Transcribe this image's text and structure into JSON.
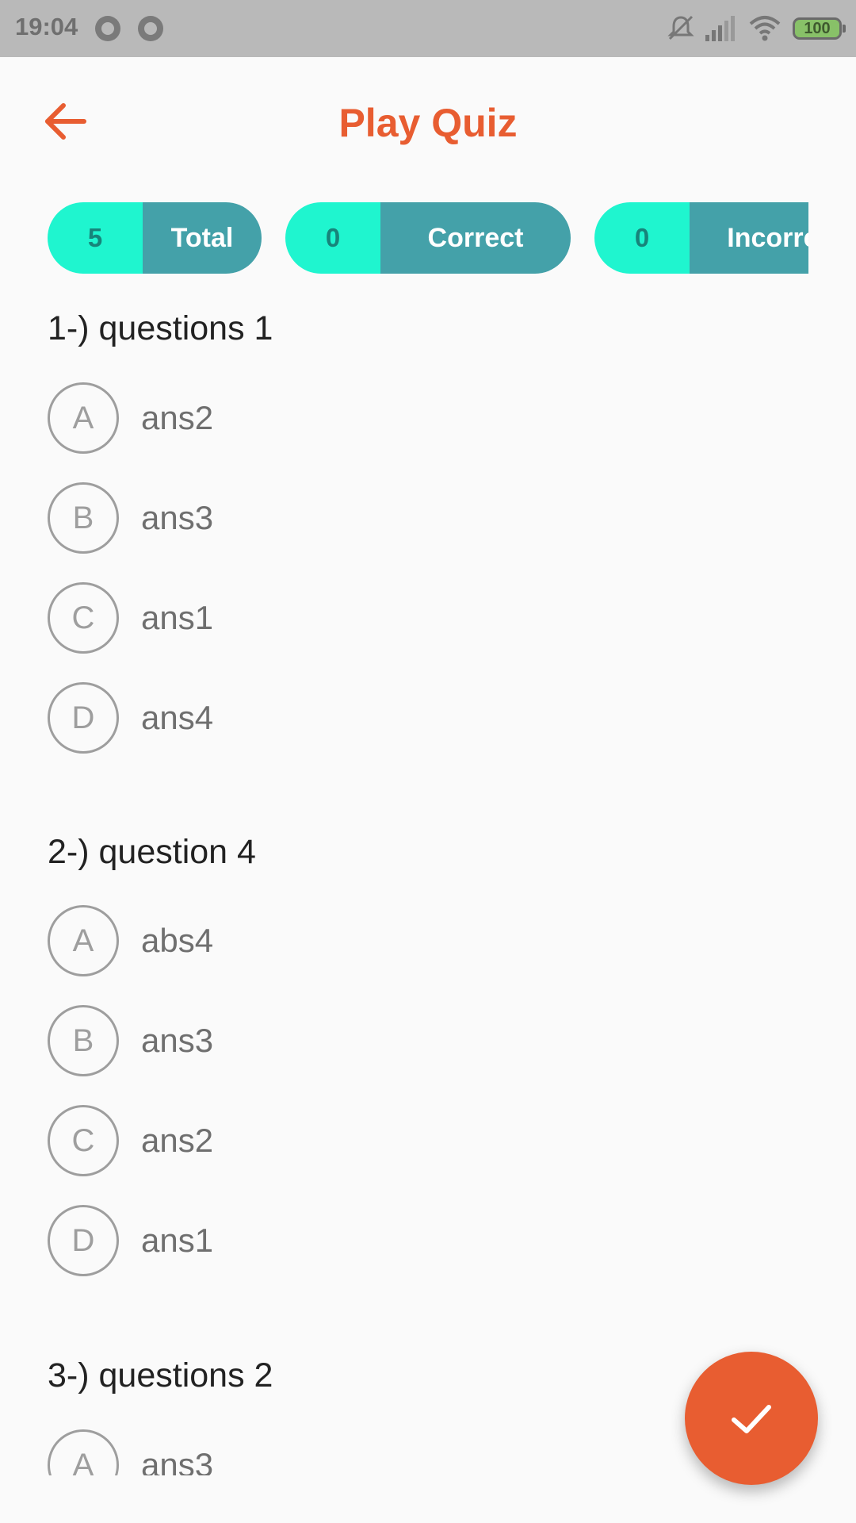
{
  "status_bar": {
    "time": "19:04",
    "battery": "100"
  },
  "header": {
    "title": "Play Quiz",
    "back_icon": "arrow-left-icon",
    "accent_color": "#e85d31"
  },
  "stats": [
    {
      "value": "5",
      "label": "Total"
    },
    {
      "value": "0",
      "label": "Correct"
    },
    {
      "value": "0",
      "label": "Incorrect"
    }
  ],
  "questions": [
    {
      "title": "1-) questions 1",
      "options": [
        {
          "letter": "A",
          "text": "ans2"
        },
        {
          "letter": "B",
          "text": "ans3"
        },
        {
          "letter": "C",
          "text": "ans1"
        },
        {
          "letter": "D",
          "text": "ans4"
        }
      ]
    },
    {
      "title": "2-) question 4",
      "options": [
        {
          "letter": "A",
          "text": "abs4"
        },
        {
          "letter": "B",
          "text": "ans3"
        },
        {
          "letter": "C",
          "text": "ans2"
        },
        {
          "letter": "D",
          "text": "ans1"
        }
      ]
    },
    {
      "title": "3-) questions 2",
      "options": [
        {
          "letter": "A",
          "text": "ans3"
        }
      ]
    }
  ],
  "fab": {
    "icon": "check-icon"
  }
}
